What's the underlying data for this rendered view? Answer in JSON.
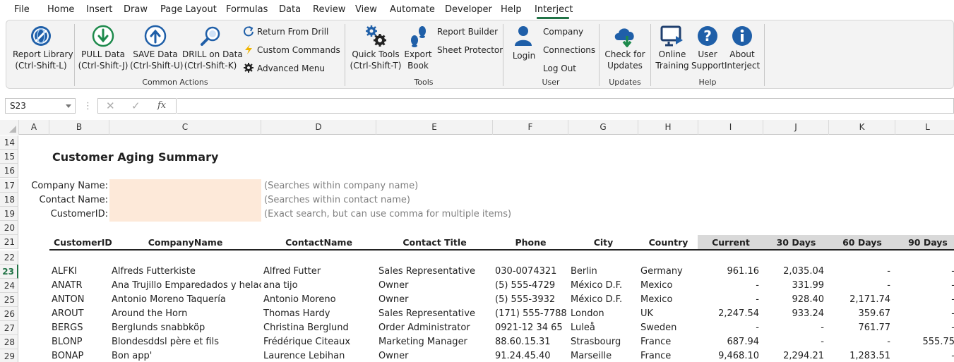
{
  "menu": {
    "tabs": [
      "File",
      "Home",
      "Insert",
      "Draw",
      "Page Layout",
      "Formulas",
      "Data",
      "Review",
      "View",
      "Automate",
      "Developer",
      "Help",
      "Interject"
    ],
    "active_tab": "Interject"
  },
  "ribbon": {
    "report_library": {
      "line1": "Report Library",
      "line2": "(Ctrl-Shift-L)"
    },
    "pull_data": {
      "line1": "PULL Data",
      "line2": "(Ctrl-Shift-J)"
    },
    "save_data": {
      "line1": "SAVE Data",
      "line2": "(Ctrl-Shift-U)"
    },
    "drill_data": {
      "line1": "DRILL on Data",
      "line2": "(Ctrl-Shift-K)"
    },
    "return_from_drill": "Return From Drill",
    "custom_commands": "Custom Commands",
    "advanced_menu": "Advanced Menu",
    "common_actions_label": "Common Actions",
    "quick_tools": {
      "line1": "Quick Tools",
      "line2": "(Ctrl-Shift-T)"
    },
    "export_book": {
      "line1": "Export",
      "line2": "Book"
    },
    "report_builder": "Report Builder",
    "sheet_protector": "Sheet Protector",
    "tools_label": "Tools",
    "login": "Login",
    "company": "Company",
    "connections": "Connections",
    "log_out": "Log Out",
    "user_label": "User",
    "check_updates": {
      "line1": "Check for",
      "line2": "Updates"
    },
    "updates_label": "Updates",
    "online_training": {
      "line1": "Online",
      "line2": "Training"
    },
    "user_support": {
      "line1": "User",
      "line2": "Support"
    },
    "about": {
      "line1": "About",
      "line2": "Interject"
    },
    "help_label": "Help"
  },
  "formula_bar": {
    "name_box": "S23",
    "fx": "fx",
    "value": ""
  },
  "columns": [
    "A",
    "B",
    "C",
    "D",
    "E",
    "F",
    "G",
    "H",
    "I",
    "J",
    "K",
    "L"
  ],
  "rows": [
    "14",
    "15",
    "16",
    "17",
    "18",
    "19",
    "20",
    "21",
    "22",
    "23",
    "24",
    "25",
    "26",
    "27",
    "28",
    "29"
  ],
  "sheet": {
    "title": "Customer Aging Summary",
    "filters": [
      {
        "label": "Company Name:",
        "value": "",
        "note": "(Searches within company name)"
      },
      {
        "label": "Contact Name:",
        "value": "",
        "note": "(Searches within contact name)"
      },
      {
        "label": "CustomerID:",
        "value": "",
        "note": "(Exact search, but can use comma for multiple items)"
      }
    ],
    "headers": [
      "CustomerID",
      "CompanyName",
      "ContactName",
      "Contact Title",
      "Phone",
      "City",
      "Country",
      "Current",
      "30 Days",
      "60 Days",
      "90 Days"
    ],
    "data": [
      [
        "ALFKI",
        "Alfreds Futterkiste",
        "Alfred Futter",
        "Sales Representative",
        "030-0074321",
        "Berlin",
        "Germany",
        "961.16",
        "2,035.04",
        "-",
        "-"
      ],
      [
        "ANATR",
        "Ana Trujillo Emparedados y helac",
        "ana tijo",
        "Owner",
        "(5) 555-4729",
        "México D.F.",
        "Mexico",
        "-",
        "331.99",
        "-",
        "-"
      ],
      [
        "ANTON",
        "Antonio Moreno Taquería",
        "Antonio Moreno",
        "Owner",
        "(5) 555-3932",
        "México D.F.",
        "Mexico",
        "-",
        "928.40",
        "2,171.74",
        "-"
      ],
      [
        "AROUT",
        "Around the Horn",
        "Thomas Hardy",
        "Sales Representative",
        "(171) 555-7788",
        "London",
        "UK",
        "2,247.54",
        "933.24",
        "359.67",
        "-"
      ],
      [
        "BERGS",
        "Berglunds snabbköp",
        "Christina Berglund",
        "Order Administrator",
        "0921-12 34 65",
        "Luleå",
        "Sweden",
        "-",
        "-",
        "761.77",
        "-"
      ],
      [
        "BLONP",
        "Blondesddsl père et fils",
        "Frédérique Citeaux",
        "Marketing Manager",
        "88.60.15.31",
        "Strasbourg",
        "France",
        "687.94",
        "-",
        "-",
        "555.75"
      ],
      [
        "BONAP",
        "Bon app'",
        "Laurence Lebihan",
        "Owner",
        "91.24.45.40",
        "Marseille",
        "France",
        "9,468.10",
        "2,294.21",
        "1,283.51",
        "-"
      ]
    ]
  }
}
